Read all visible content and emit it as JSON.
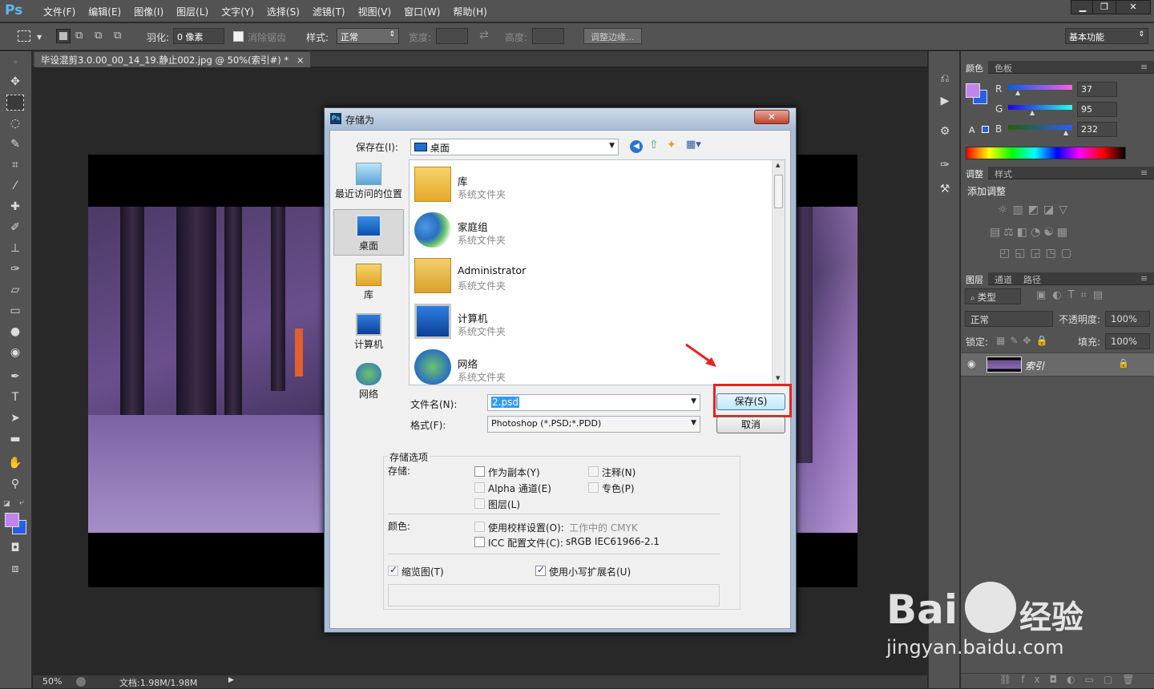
{
  "app": {
    "logo": "Ps"
  },
  "menubar": {
    "items": [
      "文件(F)",
      "编辑(E)",
      "图像(I)",
      "图层(L)",
      "文字(Y)",
      "选择(S)",
      "滤镜(T)",
      "视图(V)",
      "窗口(W)",
      "帮助(H)"
    ],
    "min": "▁",
    "restore": "❐",
    "close": "✕"
  },
  "options": {
    "feather_label": "羽化:",
    "feather_value": "0 像素",
    "antialias_label": "消除锯齿",
    "style_label": "样式:",
    "style_value": "正常",
    "width_label": "宽度:",
    "height_label": "高度:",
    "refine_edge": "调整边缘...",
    "workspace": "基本功能"
  },
  "document": {
    "tab_title": "毕设混剪3.0.00_00_14_19.静止002.jpg @ 50%(索引#) *",
    "tab_close": "×"
  },
  "status": {
    "zoom": "50%",
    "doc_info": "文档:1.98M/1.98M"
  },
  "color_panel": {
    "tabs": [
      "颜色",
      "色板"
    ],
    "r_label": "R",
    "g_label": "G",
    "b_label": "B",
    "r": "37",
    "g": "95",
    "b": "232",
    "foreground": "#c383ed",
    "background": "#255fe8"
  },
  "adjust_panel": {
    "tabs": [
      "调整",
      "样式"
    ],
    "title": "添加调整"
  },
  "layers_panel": {
    "tabs": [
      "图层",
      "通道",
      "路径"
    ],
    "filter": "类型",
    "blend": "正常",
    "opacity_label": "不透明度:",
    "opacity_value": "100%",
    "lock_label": "锁定:",
    "fill_label": "填充:",
    "fill_value": "100%",
    "layer_name": "索引"
  },
  "dialog": {
    "title": "存储为",
    "close": "✕",
    "save_in_label": "保存在(I):",
    "save_in_value": "桌面",
    "places": [
      "最近访问的位置",
      "桌面",
      "库",
      "计算机",
      "网络"
    ],
    "files": [
      {
        "name": "库",
        "sub": "系统文件夹"
      },
      {
        "name": "家庭组",
        "sub": "系统文件夹"
      },
      {
        "name": "Administrator",
        "sub": "系统文件夹"
      },
      {
        "name": "计算机",
        "sub": "系统文件夹"
      },
      {
        "name": "网络",
        "sub": "系统文件夹"
      }
    ],
    "filename_label": "文件名(N):",
    "filename_value": "2.psd",
    "format_label": "格式(F):",
    "format_value": "Photoshop (*.PSD;*.PDD)",
    "save_button": "保存(S)",
    "cancel_button": "取消",
    "options_group": "存储选项",
    "store_label": "存储:",
    "opt_copy": "作为副本(Y)",
    "opt_notes": "注释(N)",
    "opt_alpha": "Alpha 通道(E)",
    "opt_spot": "专色(P)",
    "opt_layers": "图层(L)",
    "color_label": "颜色:",
    "opt_proof": "使用校样设置(O):",
    "opt_proof_value": "工作中的 CMYK",
    "opt_icc": "ICC 配置文件(C):",
    "opt_icc_value": "sRGB IEC61966-2.1",
    "opt_thumb": "缩览图(T)",
    "opt_lowercase": "使用小写扩展名(U)"
  },
  "watermark": {
    "brand": "Bai",
    "brand2": "经验",
    "url": "jingyan.baidu.com"
  },
  "colors": {
    "highlight_red": "#e8231f",
    "ps_blue": "#5eb7f0"
  }
}
